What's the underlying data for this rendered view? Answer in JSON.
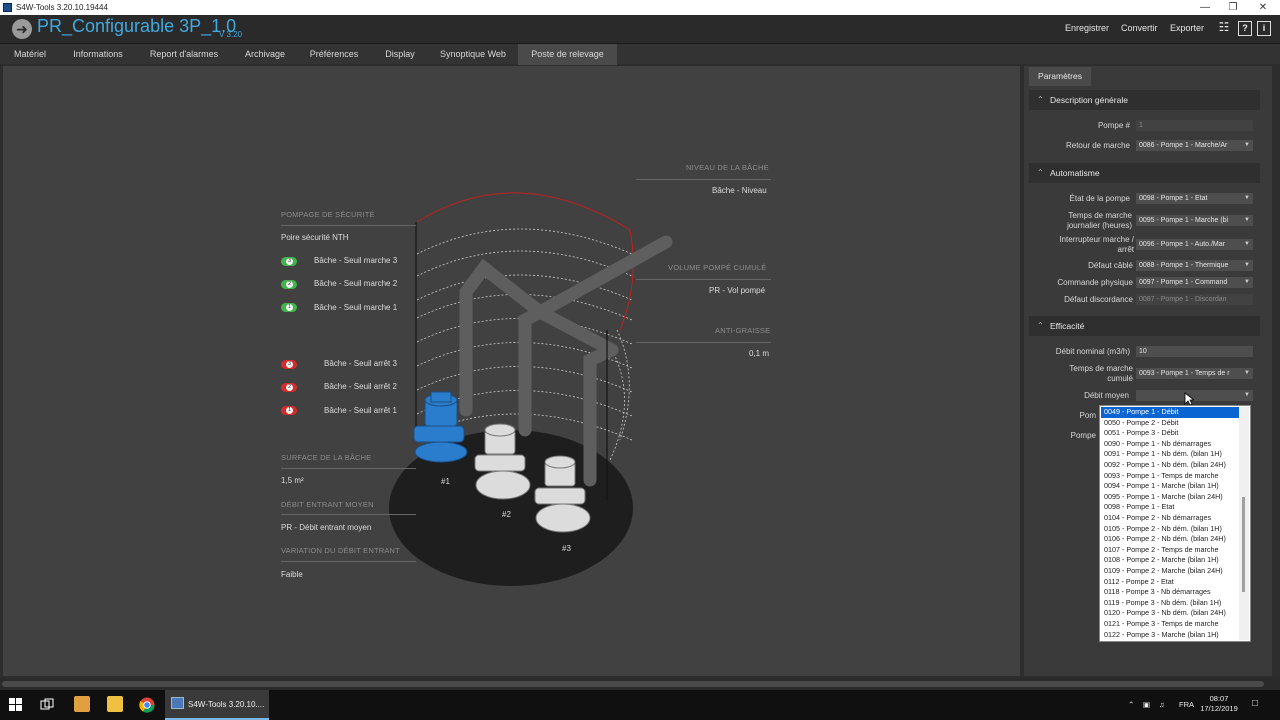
{
  "window": {
    "title": "S4W-Tools 3.20.10.19444"
  },
  "header": {
    "app_title": "PR_Configurable 3P_1.0",
    "version": "V 3.20",
    "links": [
      "Enregistrer",
      "Convertir",
      "Exporter"
    ]
  },
  "tabs": [
    "Matériel",
    "Informations",
    "Report d'alarmes",
    "Archivage",
    "Préférences",
    "Display",
    "Synoptique Web",
    "Poste de relevage"
  ],
  "active_tab": "Poste de relevage",
  "scene": {
    "left": {
      "securite_header": "POMPAGE DE SÉCURITÉ",
      "securite_value": "Poire sécurité NTH",
      "marche": [
        {
          "num": "3",
          "label": "Bâche - Seuil marche 3"
        },
        {
          "num": "2",
          "label": "Bâche - Seuil marche 2"
        },
        {
          "num": "1",
          "label": "Bâche - Seuil marche 1"
        }
      ],
      "arret": [
        {
          "num": "3",
          "label": "Bâche - Seuil arrêt 3"
        },
        {
          "num": "2",
          "label": "Bâche - Seuil arrêt 2"
        },
        {
          "num": "1",
          "label": "Bâche - Seuil arrêt 1"
        }
      ],
      "surface_header": "SURFACE DE LA BÂCHE",
      "surface_value": "1,5 m²",
      "debit_header": "DÉBIT ENTRANT MOYEN",
      "debit_value": "PR - Débit entrant moyen",
      "variation_header": "VARIATION DU DÉBIT ENTRANT",
      "variation_value": "Faible"
    },
    "right": {
      "niveau_header": "NIVEAU DE LA BÂCHE",
      "niveau_value": "Bâche - Niveau",
      "volume_header": "VOLUME POMPÉ CUMULÉ",
      "volume_value": "PR - Vol pompé",
      "anti_header": "ANTI-GRAISSE",
      "anti_value": "0,1 m"
    },
    "pump_labels": [
      "#1",
      "#2",
      "#3"
    ]
  },
  "panel": {
    "tab": "Paramètres",
    "sections": {
      "description": "Description générale",
      "automatisme": "Automatisme",
      "efficacite": "Efficacité"
    },
    "props": {
      "pompe_num": {
        "label": "Pompe #",
        "value": "1"
      },
      "retour": {
        "label": "Retour de marche",
        "value": "0086 - Pompe 1 - Marche/Ar"
      },
      "etat": {
        "label": "État de la pompe",
        "value": "0098 - Pompe 1 - Etat"
      },
      "temps_jour_l1": "Temps de marche",
      "temps_jour_l2": "journalier (heures)",
      "temps_jour": {
        "value": "0095 - Pompe 1 - Marche (bi"
      },
      "inter_l1": "Interrupteur marche /",
      "inter_l2": "arrêt",
      "inter": {
        "value": "0096 - Pompe 1 - Auto./Mar"
      },
      "defaut_cable": {
        "label": "Défaut câblé",
        "value": "0088 - Pompe 1 - Thermique"
      },
      "commande": {
        "label": "Commande physique",
        "value": "0097 - Pompe 1 - Command"
      },
      "discordance": {
        "label": "Défaut discordance",
        "value": "0087 - Pompe 1 - Discordan"
      },
      "debit_nominal": {
        "label": "Débit nominal (m3/h)",
        "value": "10"
      },
      "temps_cumule_l1": "Temps de marche",
      "temps_cumule_l2": "cumulé",
      "temps_cumule": {
        "value": "0093 - Pompe 1 - Temps de r"
      },
      "debit_moyen": {
        "label": "Débit moyen",
        "value": ""
      },
      "partial_1": "Pom",
      "partial_2": "Pompe"
    },
    "dropdown": [
      "0049 - Pompe 1 - Débit",
      "0050 - Pompe 2 - Débit",
      "0051 - Pompe 3 - Débit",
      "0090 - Pompe 1 - Nb démarrages",
      "0091 - Pompe 1 - Nb dém. (bilan 1H)",
      "0092 - Pompe 1 - Nb dém. (bilan 24H)",
      "0093 - Pompe 1 - Temps de marche",
      "0094 - Pompe 1 - Marche (bilan 1H)",
      "0095 - Pompe 1 - Marche (bilan 24H)",
      "0098 - Pompe 1 - Etat",
      "0104 - Pompe 2 - Nb démarrages",
      "0105 - Pompe 2 - Nb dém. (bilan 1H)",
      "0106 - Pompe 2 - Nb dém. (bilan 24H)",
      "0107 - Pompe 2 - Temps de marche",
      "0108 - Pompe 2 - Marche (bilan 1H)",
      "0109 - Pompe 2 - Marche (bilan 24H)",
      "0112 - Pompe 2 - Etat",
      "0118 - Pompe 3 - Nb démarrages",
      "0119 - Pompe 3 - Nb dém. (bilan 1H)",
      "0120 - Pompe 3 - Nb dém. (bilan 24H)",
      "0121 - Pompe 3 - Temps de marche",
      "0122 - Pompe 3 - Marche (bilan 1H)"
    ]
  },
  "taskbar": {
    "app_label": "S4W-Tools 3.20.10....",
    "lang": "FRA",
    "time": "08:07",
    "date": "17/12/2019"
  },
  "colors": {
    "accent": "#3fa9e0",
    "green": "#3fb54a",
    "red": "#d52b2b",
    "pump_active": "#2a7ccc"
  }
}
